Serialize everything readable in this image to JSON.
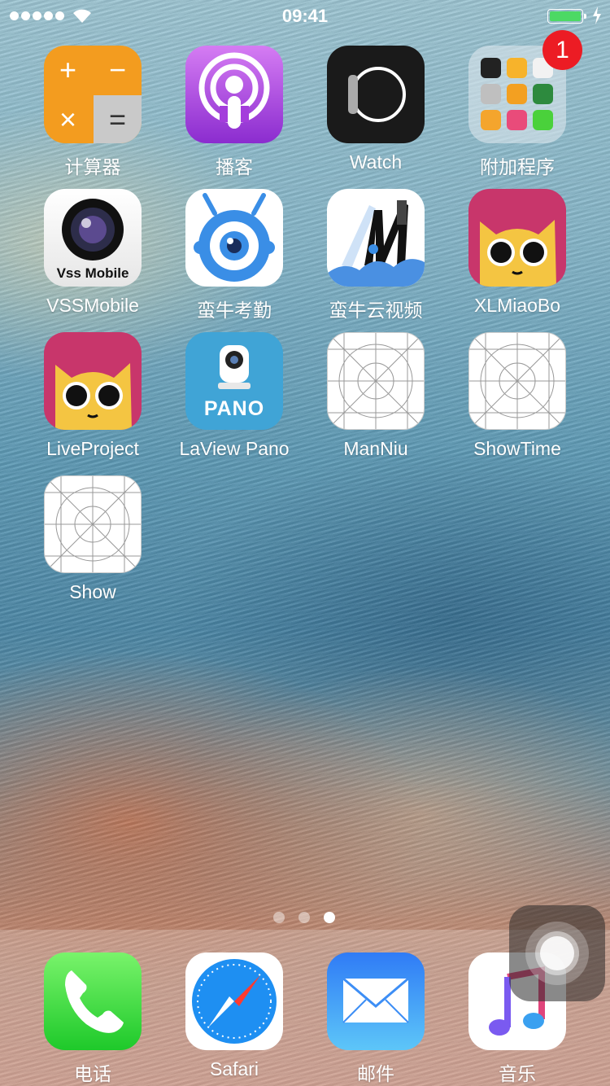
{
  "status_bar": {
    "time": "09:41",
    "signal_bars": 5,
    "battery_level": 1.0
  },
  "apps": [
    {
      "label": "计算器",
      "icon": "calculator-icon"
    },
    {
      "label": "播客",
      "icon": "podcasts-icon"
    },
    {
      "label": "Watch",
      "icon": "watch-icon"
    },
    {
      "label": "附加程序",
      "icon": "folder-icon",
      "badge": "1"
    },
    {
      "label": "VSSMobile",
      "icon": "vss-mobile-icon",
      "icon_text": "Vss Mobile"
    },
    {
      "label": "蛮牛考勤",
      "icon": "manniu-robot-icon"
    },
    {
      "label": "蛮牛云视频",
      "icon": "manniu-cloud-video-icon"
    },
    {
      "label": "XLMiaoBo",
      "icon": "cat-face-icon"
    },
    {
      "label": "LiveProject",
      "icon": "cat-face-icon"
    },
    {
      "label": "LaView Pano",
      "icon": "pano-camera-icon",
      "icon_text": "PANO"
    },
    {
      "label": "ManNiu",
      "icon": "placeholder-grid-icon"
    },
    {
      "label": "ShowTime",
      "icon": "placeholder-grid-icon"
    },
    {
      "label": "Show",
      "icon": "placeholder-grid-icon"
    }
  ],
  "page_indicator": {
    "count": 3,
    "current": 3
  },
  "dock": [
    {
      "label": "电话",
      "icon": "phone-icon"
    },
    {
      "label": "Safari",
      "icon": "safari-icon"
    },
    {
      "label": "邮件",
      "icon": "mail-icon"
    },
    {
      "label": "音乐",
      "icon": "music-icon"
    }
  ],
  "assistive_touch": {
    "icon": "assistive-touch-icon"
  },
  "colors": {
    "badge": "#ec1c24",
    "battery": "#4cd964",
    "calculator": "#f39c1f"
  }
}
